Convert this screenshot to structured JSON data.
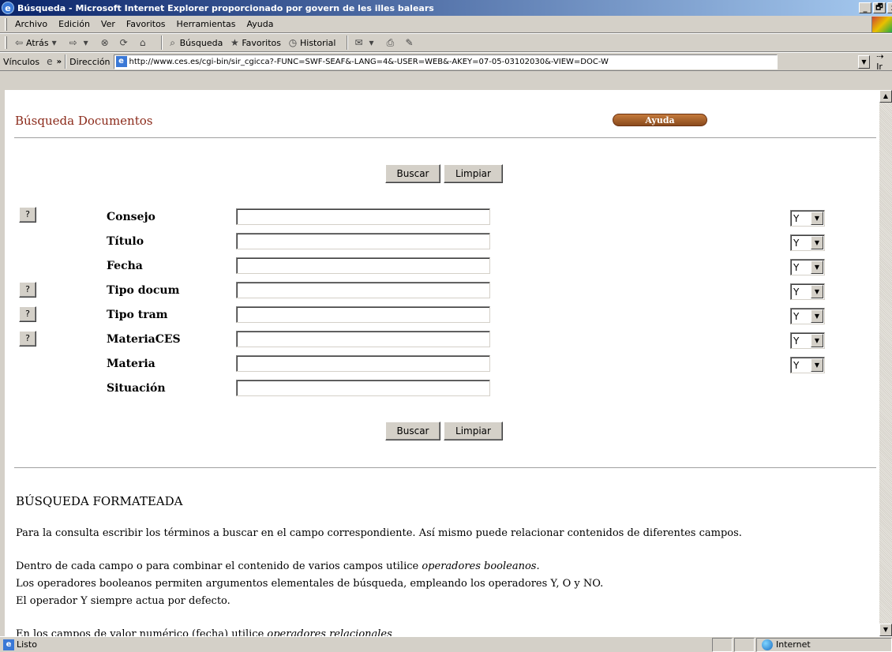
{
  "window": {
    "title": "Búsqueda - Microsoft Internet Explorer proporcionado por govern de les illes balears",
    "minimize": "_",
    "restore": "🗗",
    "close": "x"
  },
  "menu": [
    "Archivo",
    "Edición",
    "Ver",
    "Favoritos",
    "Herramientas",
    "Ayuda"
  ],
  "toolbar": {
    "back": "Atrás",
    "search": "Búsqueda",
    "favorites": "Favoritos",
    "history": "Historial"
  },
  "address": {
    "links_label": "Vínculos",
    "label": "Dirección",
    "url": "http://www.ces.es/cgi-bin/sir_cgicca?-FUNC=SWF-SEAF&-LANG=4&-USER=WEB&-AKEY=07-05-03102030&-VIEW=DOC-W",
    "go": "Ir"
  },
  "page": {
    "title": "Búsqueda Documentos",
    "help_button": "Ayuda",
    "search_button": "Buscar",
    "clear_button": "Limpiar",
    "help_q": "?",
    "fields": [
      {
        "label": "Consejo",
        "has_help": true,
        "has_op": true,
        "op": "Y"
      },
      {
        "label": "Título",
        "has_help": false,
        "has_op": true,
        "op": "Y"
      },
      {
        "label": "Fecha",
        "has_help": false,
        "has_op": true,
        "op": "Y"
      },
      {
        "label": "Tipo docum",
        "has_help": true,
        "has_op": true,
        "op": "Y"
      },
      {
        "label": "Tipo tram",
        "has_help": true,
        "has_op": true,
        "op": "Y"
      },
      {
        "label": "MateriaCES",
        "has_help": true,
        "has_op": true,
        "op": "Y"
      },
      {
        "label": "Materia",
        "has_help": false,
        "has_op": true,
        "op": "Y"
      },
      {
        "label": "Situación",
        "has_help": false,
        "has_op": false,
        "op": ""
      }
    ],
    "section_title": "BÚSQUEDA FORMATEADA",
    "para1": "Para la consulta escribir los términos a buscar en el campo correspondiente. Así mismo puede relacionar contenidos de diferentes campos.",
    "para2_a": "Dentro de cada campo o para combinar el contenido de varios campos utilice ",
    "para2_b": "operadores booleanos.",
    "para3": "Los operadores booleanos permiten argumentos elementales de búsqueda, empleando los operadores Y, O y NO.",
    "para4": "El operador Y siempre actua por defecto.",
    "para5_a": "En los campos de valor numérico (fecha) utilice ",
    "para5_b": "operadores relacionales"
  },
  "status": {
    "text": "Listo",
    "zone": "Internet"
  },
  "colors": {
    "title_red": "#8b2a1a",
    "help_button": "#a55a28",
    "titlebar": "#0a246a"
  }
}
